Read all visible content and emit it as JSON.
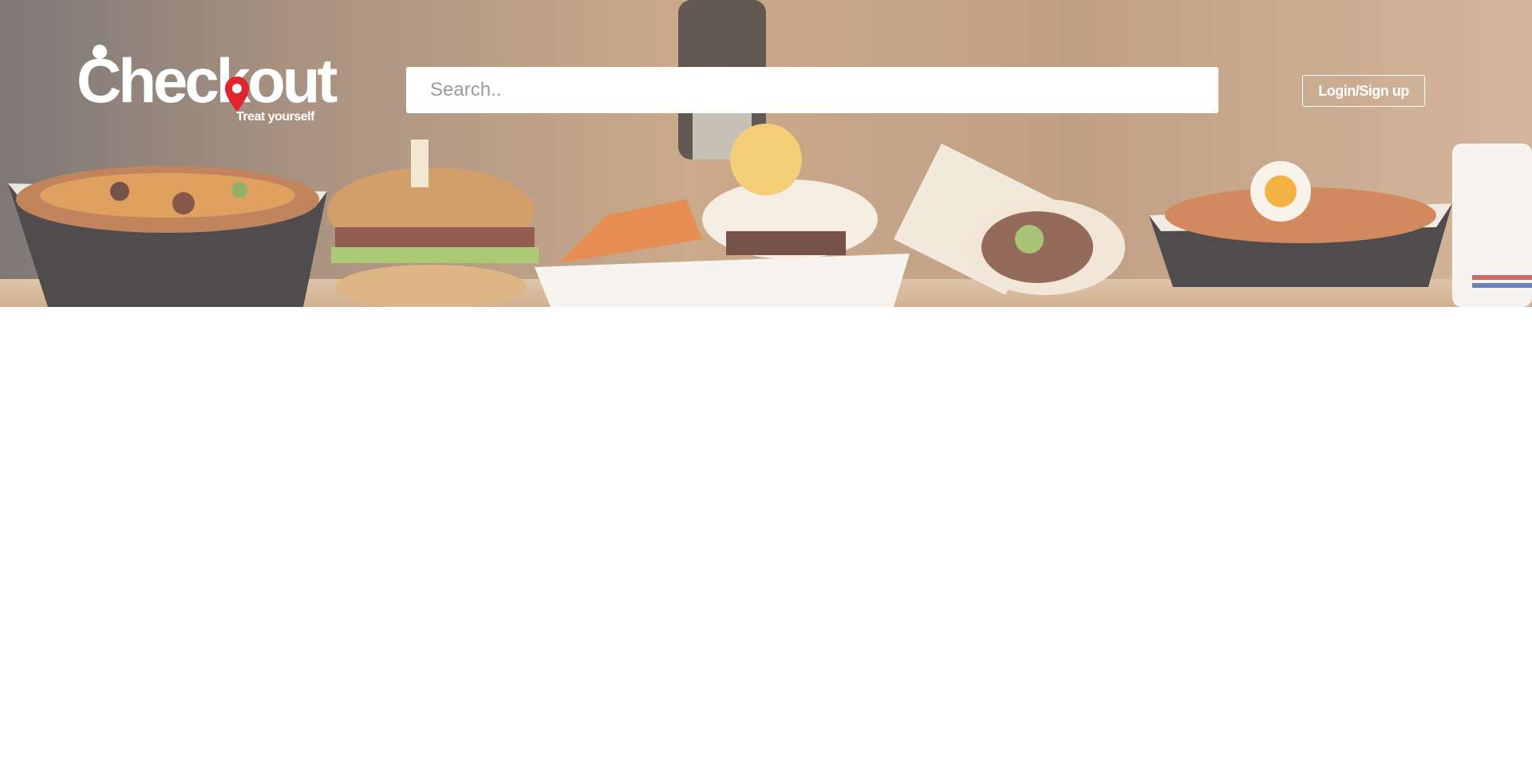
{
  "header": {
    "logo": {
      "wordmark": "Checkout",
      "tagline": "Treat yourself",
      "pin_color": "#e0262c"
    },
    "search": {
      "placeholder": "Search..",
      "value": ""
    },
    "login_label": "Login/Sign up"
  },
  "hero": {
    "image_description": "food-banner-photo"
  },
  "colors": {
    "accent": "#e0262c",
    "header_text": "#ffffff",
    "page_background": "#ffffff"
  }
}
